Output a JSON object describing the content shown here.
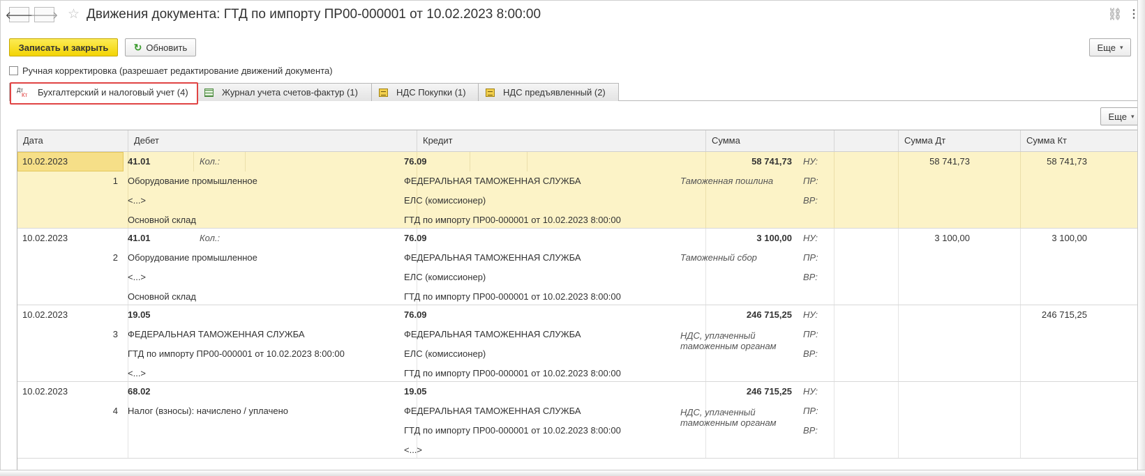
{
  "window": {
    "title": "Движения документа: ГТД по импорту ПР00-000001 от 10.02.2023 8:00:00",
    "back_glyph": "🡐",
    "forward_glyph": "🡒",
    "star_glyph": "☆",
    "link_glyph": "⛓",
    "more_glyph": "⋮"
  },
  "toolbar": {
    "save_close_label": "Записать и закрыть",
    "refresh_label": "Обновить",
    "refresh_glyph": "↻",
    "more_label": "Еще",
    "caret": "▾"
  },
  "manual_edit_label": "Ручная корректировка (разрешает редактирование движений документа)",
  "tabs": [
    {
      "label": "Бухгалтерский и налоговый учет (4)",
      "icon": "dt-kt-icon",
      "active": true
    },
    {
      "label": "Журнал учета счетов-фактур (1)",
      "icon": "grid-icon"
    },
    {
      "label": "НДС Покупки (1)",
      "icon": "register-icon"
    },
    {
      "label": "НДС предъявленный (2)",
      "icon": "register-icon"
    }
  ],
  "table_more_label": "Еще",
  "dt_icon_text": {
    "d": "Дт",
    "k": "Кт"
  },
  "columns": {
    "date": "Дата",
    "debit": "Дебет",
    "credit": "Кредит",
    "sum": "Сумма",
    "sum_dt": "Сумма Дт",
    "sum_kt": "Сумма Кт"
  },
  "kol_label": "Кол.:",
  "rows": [
    {
      "date": "10.02.2023",
      "num": "1",
      "dt_account": "41.01",
      "show_kol": true,
      "dt_lines": [
        "Оборудование промышленное",
        "<...>",
        "Основной склад"
      ],
      "kt_account": "76.09",
      "kt_lines": [
        "ФЕДЕРАЛЬНАЯ ТАМОЖЕННАЯ СЛУЖБА",
        "ЕЛС (комиссионер)",
        "ГТД по импорту ПР00-000001 от 10.02.2023 8:00:00"
      ],
      "sum": "58 741,73",
      "content": "Таможенная пошлина",
      "nu": "НУ:",
      "pr": "ПР:",
      "vr": "ВР:",
      "sum_dt": "58 741,73",
      "sum_kt": "58 741,73"
    },
    {
      "date": "10.02.2023",
      "num": "2",
      "dt_account": "41.01",
      "show_kol": true,
      "dt_lines": [
        "Оборудование промышленное",
        "<...>",
        "Основной склад"
      ],
      "kt_account": "76.09",
      "kt_lines": [
        "ФЕДЕРАЛЬНАЯ ТАМОЖЕННАЯ СЛУЖБА",
        "ЕЛС (комиссионер)",
        "ГТД по импорту ПР00-000001 от 10.02.2023 8:00:00"
      ],
      "sum": "3 100,00",
      "content": "Таможенный сбор",
      "nu": "НУ:",
      "pr": "ПР:",
      "vr": "ВР:",
      "sum_dt": "3 100,00",
      "sum_kt": "3 100,00"
    },
    {
      "date": "10.02.2023",
      "num": "3",
      "dt_account": "19.05",
      "show_kol": false,
      "dt_lines": [
        "ФЕДЕРАЛЬНАЯ ТАМОЖЕННАЯ СЛУЖБА",
        "ГТД по импорту ПР00-000001 от 10.02.2023 8:00:00",
        "<...>"
      ],
      "kt_account": "76.09",
      "kt_lines": [
        "ФЕДЕРАЛЬНАЯ ТАМОЖЕННАЯ СЛУЖБА",
        "ЕЛС (комиссионер)",
        "ГТД по импорту ПР00-000001 от 10.02.2023 8:00:00"
      ],
      "sum": "246 715,25",
      "content": "НДС, уплаченный таможенным органам",
      "nu": "НУ:",
      "pr": "ПР:",
      "vr": "ВР:",
      "sum_dt": "",
      "sum_kt": "246 715,25"
    },
    {
      "date": "10.02.2023",
      "num": "4",
      "dt_account": "68.02",
      "show_kol": false,
      "dt_lines": [
        "Налог (взносы): начислено / уплачено",
        "",
        ""
      ],
      "kt_account": "19.05",
      "kt_lines": [
        "ФЕДЕРАЛЬНАЯ ТАМОЖЕННАЯ СЛУЖБА",
        "ГТД по импорту ПР00-000001 от 10.02.2023 8:00:00",
        "<...>"
      ],
      "sum": "246 715,25",
      "content": "НДС, уплаченный таможенным органам",
      "nu": "НУ:",
      "pr": "ПР:",
      "vr": "ВР:",
      "sum_dt": "",
      "sum_kt": ""
    }
  ]
}
